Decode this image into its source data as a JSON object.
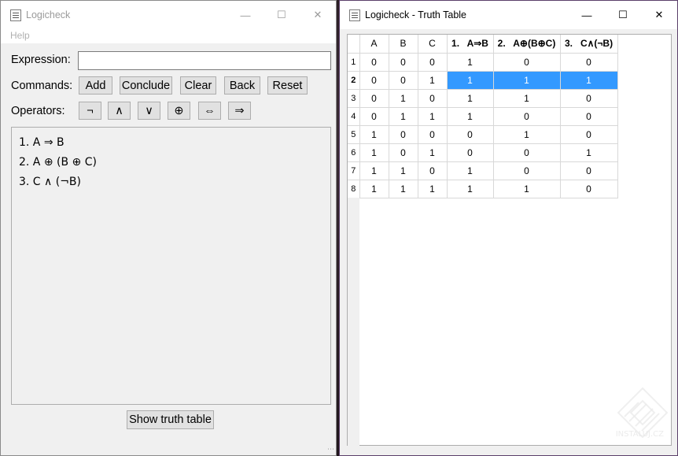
{
  "left_window": {
    "title": "Logicheck",
    "menu": [
      "Help"
    ],
    "expression_label": "Expression:",
    "expression_value": "",
    "commands_label": "Commands:",
    "commands": [
      "Add",
      "Conclude",
      "Clear",
      "Back",
      "Reset"
    ],
    "operators_label": "Operators:",
    "operators": [
      "¬",
      "∧",
      "∨",
      "⊕",
      "⇔",
      "⇒"
    ],
    "expressions": [
      "1. A ⇒ B",
      "2. A ⊕ (B ⊕ C)",
      "3. C ∧ (¬B)"
    ],
    "show_truth_table_label": "Show truth table"
  },
  "right_window": {
    "title": "Logicheck - Truth Table",
    "columns": [
      "A",
      "B",
      "C",
      "1.   A⇒B",
      "2.   A⊕(B⊕C)",
      "3.   C∧(¬B)"
    ],
    "row_headers": [
      "1",
      "2",
      "3",
      "4",
      "5",
      "6",
      "7",
      "8"
    ],
    "rows": [
      [
        "0",
        "0",
        "0",
        "1",
        "0",
        "0"
      ],
      [
        "0",
        "0",
        "1",
        "1",
        "1",
        "1"
      ],
      [
        "0",
        "1",
        "0",
        "1",
        "1",
        "0"
      ],
      [
        "0",
        "1",
        "1",
        "1",
        "0",
        "0"
      ],
      [
        "1",
        "0",
        "0",
        "0",
        "1",
        "0"
      ],
      [
        "1",
        "0",
        "1",
        "0",
        "0",
        "1"
      ],
      [
        "1",
        "1",
        "0",
        "1",
        "0",
        "0"
      ],
      [
        "1",
        "1",
        "1",
        "1",
        "1",
        "0"
      ]
    ],
    "selected_row": 2
  },
  "watermark": "INSTALUJ.CZ",
  "colors": {
    "selection": "#3399ff",
    "window_bg": "#f0f0f0"
  }
}
